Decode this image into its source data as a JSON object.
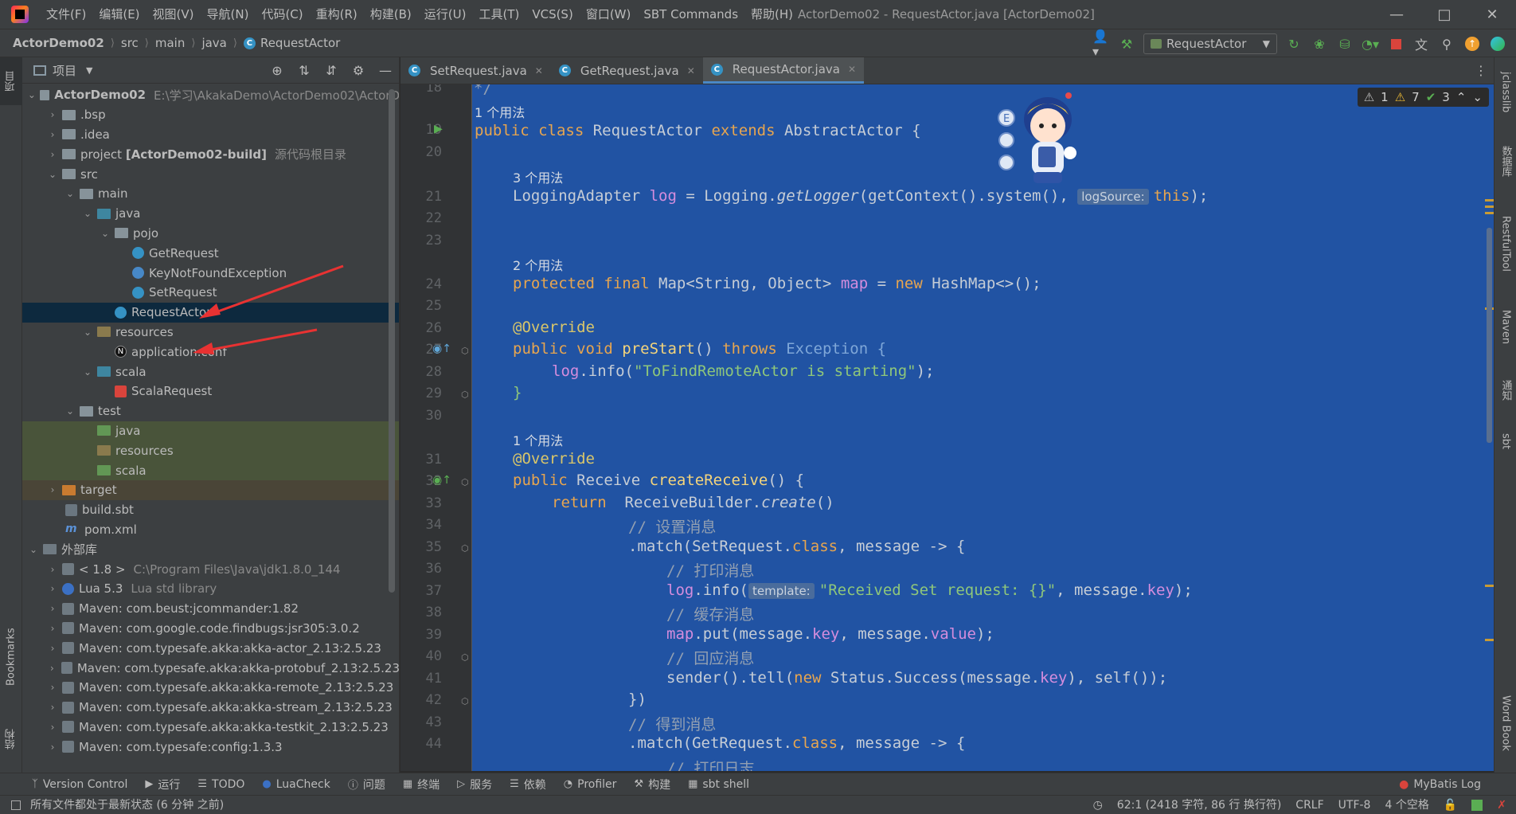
{
  "menubar": {
    "items": [
      "文件(F)",
      "编辑(E)",
      "视图(V)",
      "导航(N)",
      "代码(C)",
      "重构(R)",
      "构建(B)",
      "运行(U)",
      "工具(T)",
      "VCS(S)",
      "窗口(W)",
      "SBT Commands",
      "帮助(H)"
    ],
    "window_title": "ActorDemo02 - RequestActor.java [ActorDemo02]"
  },
  "navbar": {
    "breadcrumb": [
      "ActorDemo02",
      "src",
      "main",
      "java",
      "RequestActor"
    ],
    "run_config": "RequestActor"
  },
  "left_strip": {
    "project_label": "项目",
    "bookmarks_label": "Bookmarks",
    "structure_label": "结构"
  },
  "project_panel": {
    "title": "项目",
    "tree": [
      {
        "name": "ActorDemo02",
        "extra": "E:\\学习\\AkakaDemo\\ActorDemo02\\ActorD"
      },
      {
        "name": ".bsp"
      },
      {
        "name": ".idea"
      },
      {
        "name": "project",
        "bold_part": "[ActorDemo02-build]",
        "extra": "源代码根目录"
      },
      {
        "name": "src"
      },
      {
        "name": "main"
      },
      {
        "name": "java"
      },
      {
        "name": "pojo"
      },
      {
        "name": "GetRequest"
      },
      {
        "name": "KeyNotFoundException"
      },
      {
        "name": "SetRequest"
      },
      {
        "name": "RequestActor"
      },
      {
        "name": "resources"
      },
      {
        "name": "application.conf"
      },
      {
        "name": "scala"
      },
      {
        "name": "ScalaRequest"
      },
      {
        "name": "test"
      },
      {
        "name": "java"
      },
      {
        "name": "resources"
      },
      {
        "name": "scala"
      },
      {
        "name": "target"
      },
      {
        "name": "build.sbt"
      },
      {
        "name": "pom.xml"
      },
      {
        "name": "外部库"
      },
      {
        "name": "< 1.8 >",
        "extra": "C:\\Program Files\\Java\\jdk1.8.0_144"
      },
      {
        "name": "Lua 5.3",
        "extra": "Lua std library"
      },
      {
        "name": "Maven: com.beust:jcommander:1.82"
      },
      {
        "name": "Maven: com.google.code.findbugs:jsr305:3.0.2"
      },
      {
        "name": "Maven: com.typesafe.akka:akka-actor_2.13:2.5.23"
      },
      {
        "name": "Maven: com.typesafe.akka:akka-protobuf_2.13:2.5.23"
      },
      {
        "name": "Maven: com.typesafe.akka:akka-remote_2.13:2.5.23"
      },
      {
        "name": "Maven: com.typesafe.akka:akka-stream_2.13:2.5.23"
      },
      {
        "name": "Maven: com.typesafe.akka:akka-testkit_2.13:2.5.23"
      },
      {
        "name": "Maven: com.typesafe:config:1.3.3"
      }
    ]
  },
  "editor": {
    "tabs": [
      "SetRequest.java",
      "GetRequest.java",
      "RequestActor.java"
    ],
    "active_tab": "RequestActor.java",
    "inspection": {
      "weak_warnings": "1",
      "warnings": "7",
      "typos": "3"
    },
    "line_numbers": [
      "18",
      "19",
      "20",
      "21",
      "22",
      "23",
      "24",
      "25",
      "26",
      "27",
      "28",
      "29",
      "30",
      "31",
      "32",
      "33",
      "34",
      "35",
      "36",
      "37",
      "38",
      "39",
      "40",
      "41",
      "42",
      "43",
      "44"
    ],
    "usage_hints": [
      "1 个用法",
      "3 个用法",
      "2 个用法",
      "1 个用法"
    ],
    "inlay_hints": [
      "logSource:",
      "template:"
    ],
    "code": {
      "l18": "*/",
      "l19_a": "public class ",
      "l19_b": "RequestActor ",
      "l19_c": "extends ",
      "l19_d": "AbstractActor {",
      "l21_a": "LoggingAdapter ",
      "l21_b": "log",
      "l21_c": " = Logging.",
      "l21_d": "getLogger",
      "l21_e": "(getContext().system(), ",
      "l21_f": "this",
      "l21_g": ");",
      "l24_a": "protected final ",
      "l24_b": "Map<String, Object> ",
      "l24_c": "map",
      "l24_d": " = ",
      "l24_e": "new ",
      "l24_f": "HashMap<>();",
      "l26": "@Override",
      "l27_a": "public void ",
      "l27_b": "preStart",
      "l27_c": "() ",
      "l27_d": "throws ",
      "l27_e": "Exception {",
      "l28_a": "log",
      "l28_b": ".info(",
      "l28_c": "\"ToFindRemoteActor is starting\"",
      "l28_d": ");",
      "l29": "}",
      "l31": "@Override",
      "l32_a": "public ",
      "l32_b": "Receive ",
      "l32_c": "createReceive",
      "l32_d": "() {",
      "l33_a": "return ",
      "l33_b": " ReceiveBuilder.",
      "l33_c": "create",
      "l33_d": "()",
      "l34": "// 设置消息",
      "l35_a": ".match(SetRequest.",
      "l35_b": "class",
      "l35_c": ", message -> {",
      "l36": "// 打印消息",
      "l37_a": "log",
      "l37_b": ".info(",
      "l37_c": "\"Received Set request: {}\"",
      "l37_d": ", message.",
      "l37_e": "key",
      "l37_f": ");",
      "l38": "// 缓存消息",
      "l39_a": "map",
      "l39_b": ".put(message.",
      "l39_c": "key",
      "l39_d": ", message.",
      "l39_e": "value",
      "l39_f": ");",
      "l40": "// 回应消息",
      "l41_a": "sender().tell(",
      "l41_b": "new ",
      "l41_c": "Status.Success(message.",
      "l41_d": "key",
      "l41_e": "), self());",
      "l42": "})",
      "l43": "// 得到消息",
      "l44_a": ".match(GetRequest.",
      "l44_b": "class",
      "l44_c": ", message -> {",
      "l45": "// 打印日志"
    }
  },
  "right_strip": {
    "tabs": [
      "jclasslib",
      "数据库",
      "RestfulTool",
      "Maven",
      "通知",
      "sbt",
      "Word Book"
    ]
  },
  "bottom_bar": {
    "tools": [
      "Version Control",
      "运行",
      "TODO",
      "LuaCheck",
      "问题",
      "终端",
      "服务",
      "依赖",
      "Profiler",
      "构建",
      "sbt shell"
    ],
    "right_tool": "MyBatis Log"
  },
  "statusbar": {
    "message": "所有文件都处于最新状态 (6 分钟 之前)",
    "position": "62:1 (2418 字符, 86 行 换行符)",
    "line_sep": "CRLF",
    "encoding": "UTF-8",
    "indent": "4 个空格"
  },
  "colors": {
    "selection_bg": "#2153a3",
    "keyword": "#e7a54f",
    "string": "#8fc77a",
    "field": "#d48ddd",
    "annotation": "#d9c66a",
    "panel_bg": "#3c3f41",
    "arrow_red": "#e83232"
  }
}
